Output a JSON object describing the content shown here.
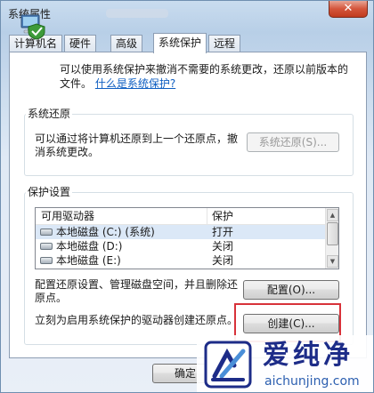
{
  "window": {
    "title": "系统属性",
    "close_glyph": "✕"
  },
  "tabs": [
    {
      "label": "计算机名"
    },
    {
      "label": "硬件"
    },
    {
      "label": "高级"
    },
    {
      "label": "系统保护",
      "active": true
    },
    {
      "label": "远程"
    }
  ],
  "intro": {
    "text": "可以使用系统保护来撤消不需要的系统更改，还原以前版本的文件。",
    "link": "什么是系统保护?",
    "icon": "computer-shield-icon"
  },
  "system_restore": {
    "label": "系统还原",
    "description": "可以通过将计算机还原到上一个还原点，撤消系统更改。",
    "button": "系统还原(S)..."
  },
  "protection_settings": {
    "label": "保护设置",
    "columns": [
      "可用驱动器",
      "保护"
    ],
    "rows": [
      {
        "drive": "本地磁盘 (C:) (系统)",
        "protection": "打开",
        "icon": "drive-icon"
      },
      {
        "drive": "本地磁盘 (D:)",
        "protection": "关闭",
        "icon": "drive-icon"
      },
      {
        "drive": "本地磁盘 (E:)",
        "protection": "关闭",
        "icon": "drive-icon"
      }
    ],
    "configure_text": "配置还原设置、管理磁盘空间，并且删除还原点。",
    "configure_button": "配置(O)...",
    "create_text": "立刻为启用系统保护的驱动器创建还原点。",
    "create_button": "创建(C)..."
  },
  "footer": {
    "ok_button": "确定"
  },
  "watermark": {
    "title": "爱纯净",
    "url": "aichunjing.com"
  },
  "colors": {
    "link": "#0f5fc2",
    "highlight": "#d8323a",
    "watermark_blue": "#1d2c88"
  }
}
